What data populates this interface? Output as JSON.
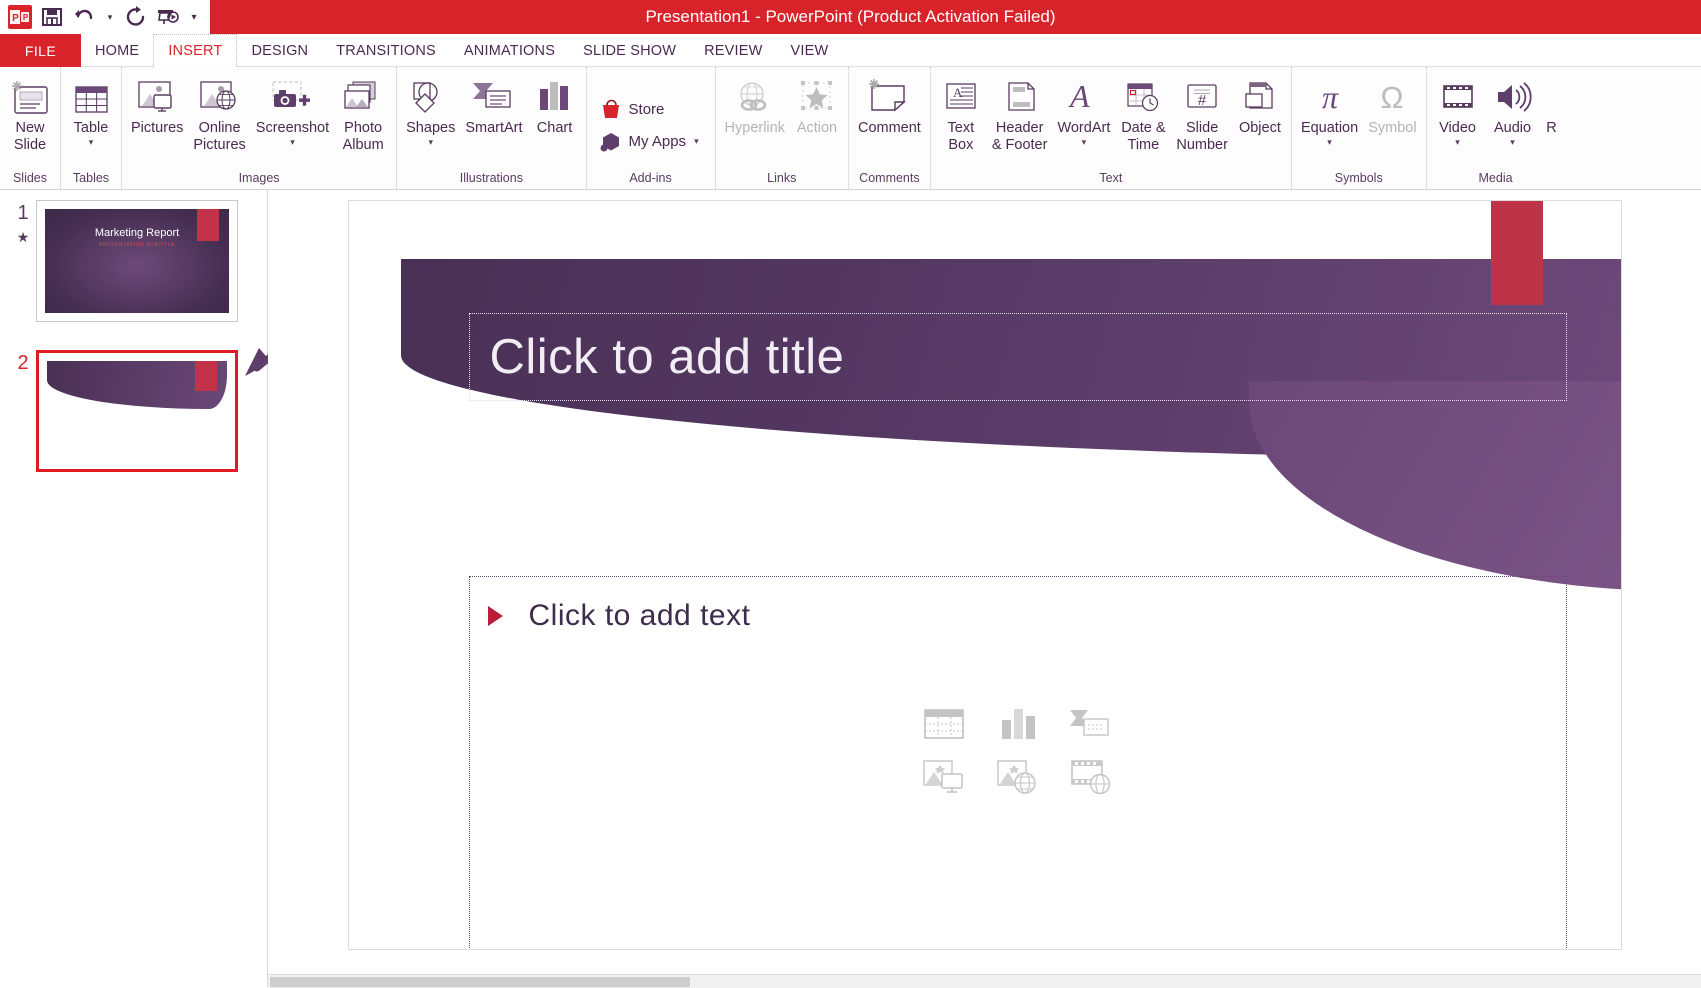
{
  "window": {
    "title": "Presentation1 -  PowerPoint (Product Activation Failed)",
    "logo_text": "P",
    "accent_red": "#d8232a",
    "accent_purple": "#4a2a50"
  },
  "quick_access": [
    {
      "name": "save-icon",
      "glyph": "💾"
    },
    {
      "name": "undo-icon",
      "glyph": "↶"
    },
    {
      "name": "undo-dropdown-icon",
      "glyph": "▾"
    },
    {
      "name": "redo-icon",
      "glyph": "↻"
    },
    {
      "name": "start-slideshow-icon",
      "glyph": "⎙"
    },
    {
      "name": "customize-qat-icon",
      "glyph": "▾"
    }
  ],
  "tabs": [
    {
      "label": "FILE",
      "active": false,
      "file": true
    },
    {
      "label": "HOME",
      "active": false
    },
    {
      "label": "INSERT",
      "active": true
    },
    {
      "label": "DESIGN",
      "active": false
    },
    {
      "label": "TRANSITIONS",
      "active": false
    },
    {
      "label": "ANIMATIONS",
      "active": false
    },
    {
      "label": "SLIDE SHOW",
      "active": false
    },
    {
      "label": "REVIEW",
      "active": false
    },
    {
      "label": "VIEW",
      "active": false
    }
  ],
  "ribbon": {
    "groups": [
      {
        "label": "Slides",
        "buttons": [
          {
            "label": "New\nSlide",
            "icon": "new-slide-icon",
            "caret": true,
            "caret_inline": true,
            "disabled": false
          }
        ]
      },
      {
        "label": "Tables",
        "buttons": [
          {
            "label": "Table",
            "icon": "table-icon",
            "caret": true,
            "disabled": false
          }
        ]
      },
      {
        "label": "Images",
        "buttons": [
          {
            "label": "Pictures",
            "icon": "pictures-icon",
            "caret": false,
            "disabled": false
          },
          {
            "label": "Online\nPictures",
            "icon": "online-pictures-icon",
            "caret": false,
            "disabled": false
          },
          {
            "label": "Screenshot",
            "icon": "screenshot-icon",
            "caret": true,
            "disabled": false
          },
          {
            "label": "Photo\nAlbum",
            "icon": "photo-album-icon",
            "caret": true,
            "caret_inline": true,
            "disabled": false
          }
        ]
      },
      {
        "label": "Illustrations",
        "buttons": [
          {
            "label": "Shapes",
            "icon": "shapes-icon",
            "caret": true,
            "disabled": false
          },
          {
            "label": "SmartArt",
            "icon": "smartart-icon",
            "caret": false,
            "disabled": false
          },
          {
            "label": "Chart",
            "icon": "chart-icon",
            "caret": false,
            "disabled": false
          }
        ]
      },
      {
        "label": "Add-ins",
        "small_buttons": [
          {
            "label": "Store",
            "icon": "store-icon",
            "caret": false,
            "disabled": false
          },
          {
            "label": "My Apps",
            "icon": "my-apps-icon",
            "caret": true,
            "disabled": false
          }
        ]
      },
      {
        "label": "Links",
        "buttons": [
          {
            "label": "Hyperlink",
            "icon": "hyperlink-icon",
            "caret": false,
            "disabled": true
          },
          {
            "label": "Action",
            "icon": "action-icon",
            "caret": false,
            "disabled": true
          }
        ]
      },
      {
        "label": "Comments",
        "buttons": [
          {
            "label": "Comment",
            "icon": "comment-icon",
            "caret": false,
            "disabled": false
          }
        ]
      },
      {
        "label": "Text",
        "buttons": [
          {
            "label": "Text\nBox",
            "icon": "text-box-icon",
            "caret": false,
            "disabled": false
          },
          {
            "label": "Header\n& Footer",
            "icon": "header-footer-icon",
            "caret": false,
            "disabled": false
          },
          {
            "label": "WordArt",
            "icon": "wordart-icon",
            "caret": true,
            "disabled": false
          },
          {
            "label": "Date &\nTime",
            "icon": "date-time-icon",
            "caret": false,
            "disabled": false
          },
          {
            "label": "Slide\nNumber",
            "icon": "slide-number-icon",
            "caret": false,
            "disabled": false
          },
          {
            "label": "Object",
            "icon": "object-icon",
            "caret": false,
            "disabled": false
          }
        ]
      },
      {
        "label": "Symbols",
        "buttons": [
          {
            "label": "Equation",
            "icon": "equation-icon",
            "caret": true,
            "disabled": false
          },
          {
            "label": "Symbol",
            "icon": "symbol-icon",
            "caret": false,
            "disabled": true
          }
        ]
      },
      {
        "label": "Media",
        "buttons": [
          {
            "label": "Video",
            "icon": "video-icon",
            "caret": true,
            "disabled": false
          },
          {
            "label": "Audio",
            "icon": "audio-icon",
            "caret": true,
            "disabled": false
          }
        ]
      },
      {
        "label": "",
        "buttons": [
          {
            "label": "R",
            "icon": "screen-recording-icon",
            "caret": false,
            "disabled": false
          }
        ]
      }
    ]
  },
  "slides_panel": {
    "slides": [
      {
        "number": "1",
        "selected": false,
        "has_animation_star": true,
        "title": "Marketing Report",
        "subtitle": "PRESENTATION SUBTITLE"
      },
      {
        "number": "2",
        "selected": true,
        "has_animation_star": false,
        "title": "",
        "subtitle": ""
      }
    ]
  },
  "editor": {
    "title_placeholder": "Click to add title",
    "content_placeholder": "Click to add text",
    "content_icons": [
      {
        "name": "insert-table-icon"
      },
      {
        "name": "insert-chart-icon"
      },
      {
        "name": "insert-smartart-icon"
      },
      {
        "name": "insert-pictures-icon"
      },
      {
        "name": "insert-online-pictures-icon"
      },
      {
        "name": "insert-video-icon"
      }
    ]
  }
}
